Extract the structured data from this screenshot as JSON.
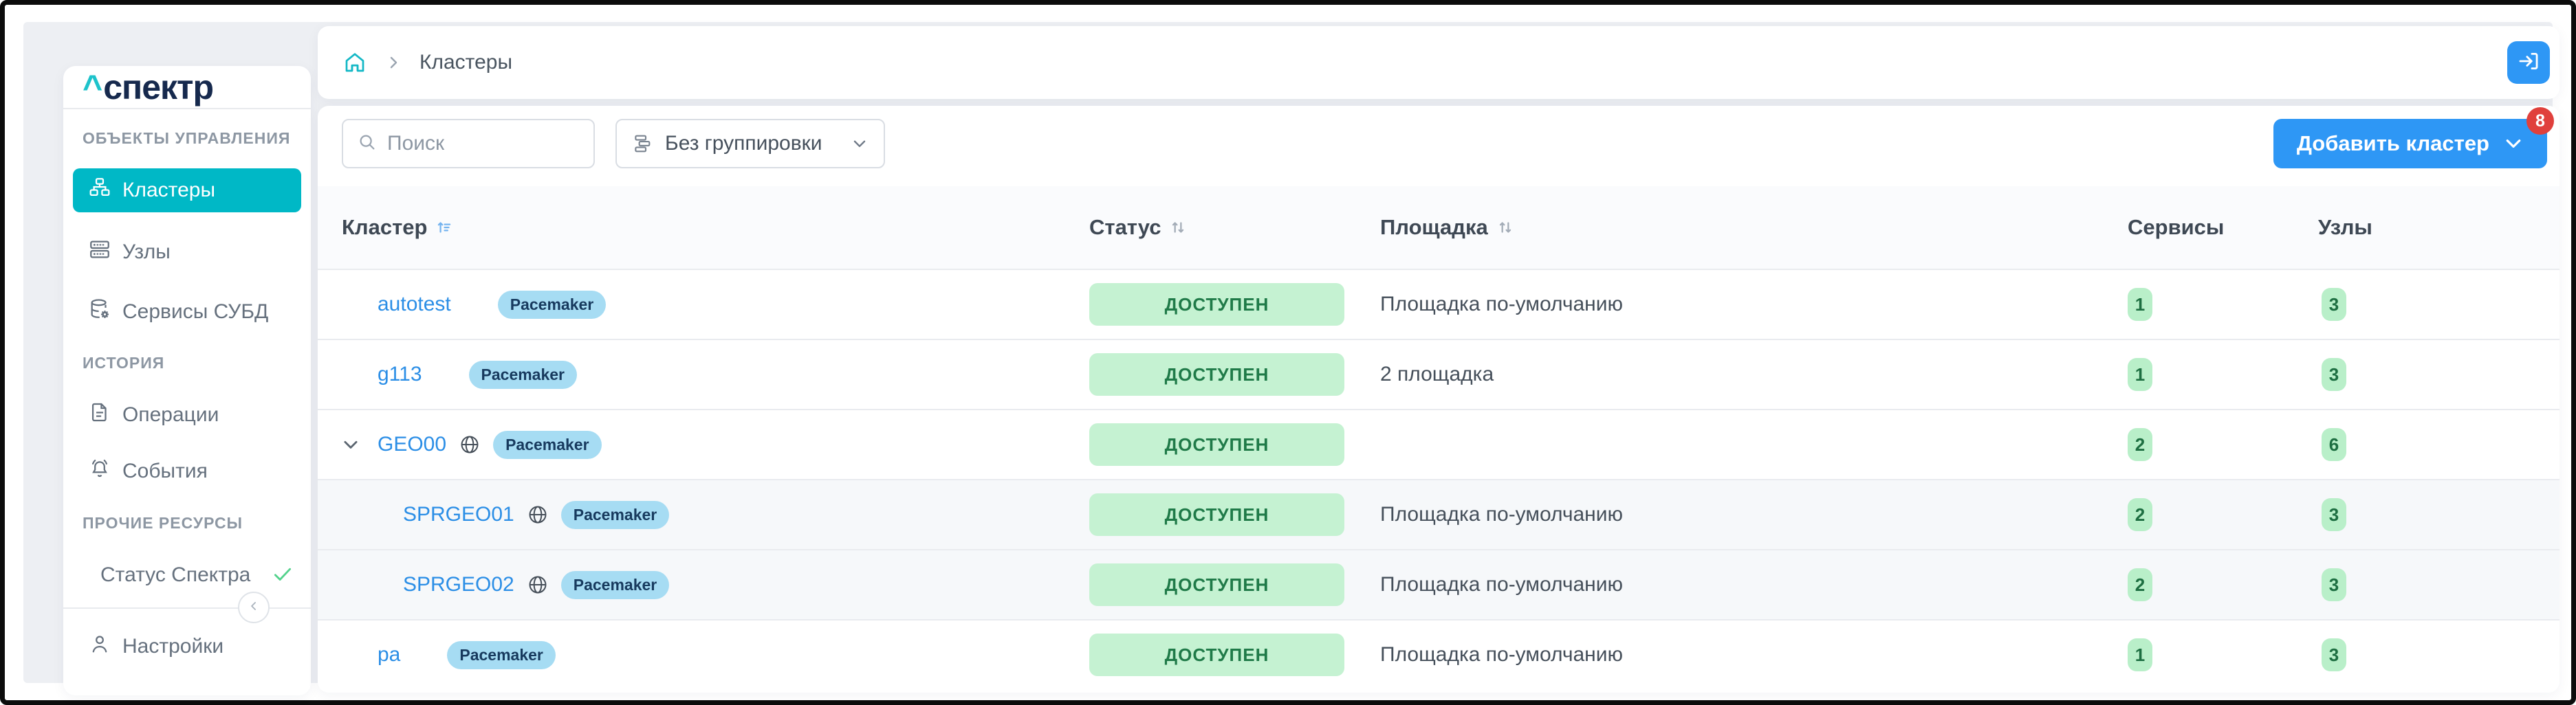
{
  "sidebar": {
    "logo": {
      "caret": "^",
      "text": "спектр"
    },
    "sections": [
      {
        "label": "ОБЪЕКТЫ УПРАВЛЕНИЯ",
        "items": [
          {
            "label": "Кластеры"
          },
          {
            "label": "Узлы"
          },
          {
            "label": "Сервисы СУБД"
          }
        ]
      },
      {
        "label": "ИСТОРИЯ",
        "items": [
          {
            "label": "Операции"
          },
          {
            "label": "События"
          }
        ]
      },
      {
        "label": "ПРОЧИЕ РЕСУРСЫ",
        "items": [
          {
            "label": "Статус Спектра"
          }
        ]
      }
    ],
    "settings_label": "Настройки"
  },
  "breadcrumb": {
    "current": "Кластеры"
  },
  "toolbar": {
    "search_placeholder": "Поиск",
    "grouping_value": "Без группировки",
    "add_cluster_label": "Добавить кластер",
    "add_cluster_badge": "8"
  },
  "table": {
    "headers": {
      "cluster": "Кластер",
      "status": "Статус",
      "site": "Площадка",
      "services": "Сервисы",
      "nodes": "Узлы"
    },
    "rows": [
      {
        "name": "autotest",
        "engine": "Pacemaker",
        "status": "ДОСТУПЕН",
        "site": "Площадка по-умолчанию",
        "services": "1",
        "nodes": "3",
        "expandable": false,
        "geo": false,
        "child": false
      },
      {
        "name": "g113",
        "engine": "Pacemaker",
        "status": "ДОСТУПЕН",
        "site": "2 площадка",
        "services": "1",
        "nodes": "3",
        "expandable": false,
        "geo": false,
        "child": false
      },
      {
        "name": "GEO00",
        "engine": "Pacemaker",
        "status": "ДОСТУПЕН",
        "site": "",
        "services": "2",
        "nodes": "6",
        "expandable": true,
        "geo": true,
        "child": false
      },
      {
        "name": "SPRGEO01",
        "engine": "Pacemaker",
        "status": "ДОСТУПЕН",
        "site": "Площадка по-умолчанию",
        "services": "2",
        "nodes": "3",
        "expandable": false,
        "geo": true,
        "child": true
      },
      {
        "name": "SPRGEO02",
        "engine": "Pacemaker",
        "status": "ДОСТУПЕН",
        "site": "Площадка по-умолчанию",
        "services": "2",
        "nodes": "3",
        "expandable": false,
        "geo": true,
        "child": true
      },
      {
        "name": "pa",
        "engine": "Pacemaker",
        "status": "ДОСТУПЕН",
        "site": "Площадка по-умолчанию",
        "services": "1",
        "nodes": "3",
        "expandable": false,
        "geo": false,
        "child": false
      }
    ]
  },
  "colors": {
    "accent_teal": "#00b8c6",
    "logo_navy": "#16294d",
    "link_blue": "#2b8ee6",
    "button_blue": "#2e97f5",
    "badge_red": "#e0403c",
    "status_green_bg": "#c5f2d2",
    "status_green_text": "#1f7a48",
    "count_green_bg": "#b9efc9",
    "engine_badge_bg": "#a6dcf3",
    "engine_badge_text": "#173a5e",
    "app_background": "#edeff3"
  }
}
